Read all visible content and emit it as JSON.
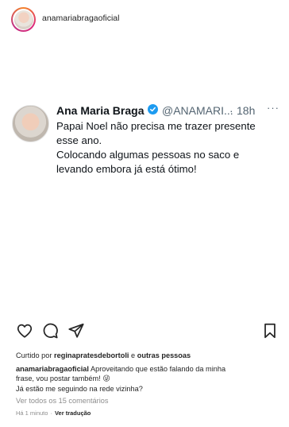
{
  "post": {
    "username": "anamariabragaoficial",
    "more_icon": "more-horizontal-icon"
  },
  "tweet": {
    "name": "Ana Maria Braga",
    "handle": "@ANAMARI...",
    "separator": "·",
    "time": "18h",
    "lines": [
      "Papai Noel não precisa me trazer presente",
      "esse ano.",
      "Colocando algumas pessoas no saco e",
      "levando embora já está ótimo!"
    ],
    "verified_color": "#1d9bf0"
  },
  "actions": {
    "like_icon": "heart-icon",
    "comment_icon": "comment-icon",
    "share_icon": "send-icon",
    "save_icon": "bookmark-icon"
  },
  "caption": {
    "likes_prefix": "Curtido por",
    "likes_user": "reginapratesdebortoli",
    "likes_conj": "e",
    "likes_others": "outras pessoas",
    "author": "anamariabragaoficial",
    "text_line1": "Aproveitando que estão falando da minha",
    "text_line2": "frase, vou postar também! 😜",
    "text_line3": "Já estão me seguindo na rede vizinha?",
    "view_comments": "Ver todos os 15 comentários",
    "posted_time": "Há 1 minuto",
    "dot": "·",
    "translate": "Ver tradução"
  }
}
